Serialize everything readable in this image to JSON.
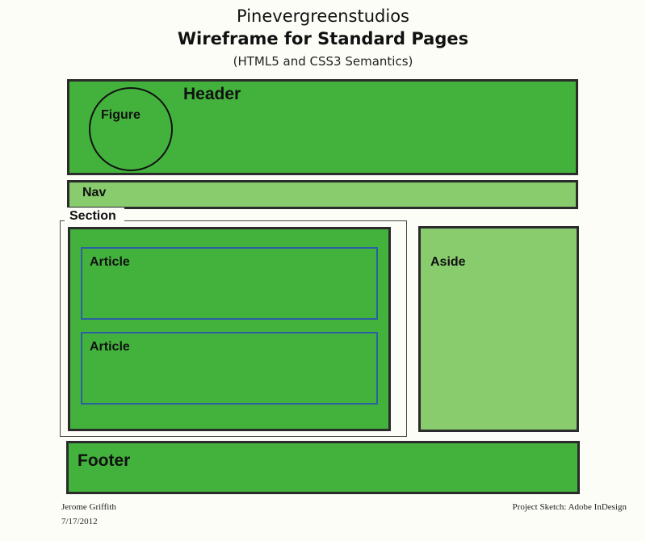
{
  "title": {
    "line1": "Pinevergreenstudios",
    "line2": "Wireframe for Standard Pages",
    "line3": "(HTML5 and CSS3 Semantics)"
  },
  "regions": {
    "header": "Header",
    "figure": "Figure",
    "nav": "Nav",
    "section": "Section",
    "article_1": "Article",
    "article_2": "Article",
    "aside": "Aside",
    "footer": "Footer"
  },
  "footnotes": {
    "author": "Jerome Griffith",
    "date": "7/17/2012",
    "project": "Project Sketch: Adobe InDesign"
  },
  "colors": {
    "dark_green": "#43b23c",
    "light_green": "#88cc6e",
    "article_border": "#2c5fa3",
    "box_border": "#2b2b2b"
  }
}
